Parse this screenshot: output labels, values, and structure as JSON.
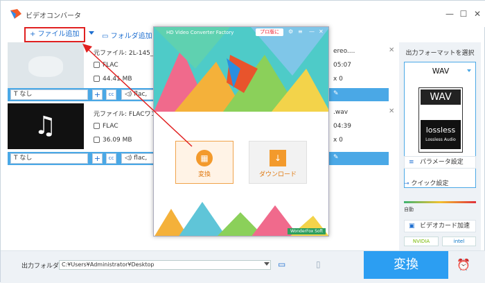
{
  "app": {
    "title": "ビデオコンバータ"
  },
  "window": {
    "minimize": "—",
    "maximize": "☐",
    "close": "✕"
  },
  "toolbar": {
    "add_file": "+ ファイル追加",
    "add_folder": "フォルダ追加"
  },
  "files": [
    {
      "source": "元ファイル: 2L-145_0",
      "source_tail": "ereo....",
      "format": "FLAC",
      "size": "44.41 MB",
      "duration": "05:07",
      "count": "x 0",
      "subtitle": "なし",
      "audio": "flac,"
    },
    {
      "source": "元ファイル: FLACワン",
      "source_tail": ".wav",
      "format": "FLAC",
      "size": "36.09 MB",
      "duration": "04:39",
      "count": "x 0",
      "subtitle": "なし",
      "audio": "flac,"
    }
  ],
  "popup": {
    "title": "HD Video Converter Factory",
    "pro": "プロ版に",
    "convert_label": "変換",
    "download_label": "ダウンロード",
    "footer": "WonderFox Soft"
  },
  "output": {
    "select_label": "出力フォーマットを選択",
    "format": "WAV",
    "badge_top": "WAV",
    "badge_lossless": "lossless",
    "badge_sub": "Lossless Audio",
    "params": "パラメータ設定",
    "quick": "クイック設定",
    "auto": "自動",
    "gpu": "ビデオカード加速",
    "nvidia": "NVIDIA",
    "intel": "intel"
  },
  "bottom": {
    "folder_label": "出力フォルダ：",
    "path": "C:¥Users¥Administrator¥Desktop",
    "convert": "変換"
  },
  "colors": {
    "accent": "#2c9ef2",
    "row_bar": "#4aa8e6",
    "highlight": "#e02020"
  }
}
